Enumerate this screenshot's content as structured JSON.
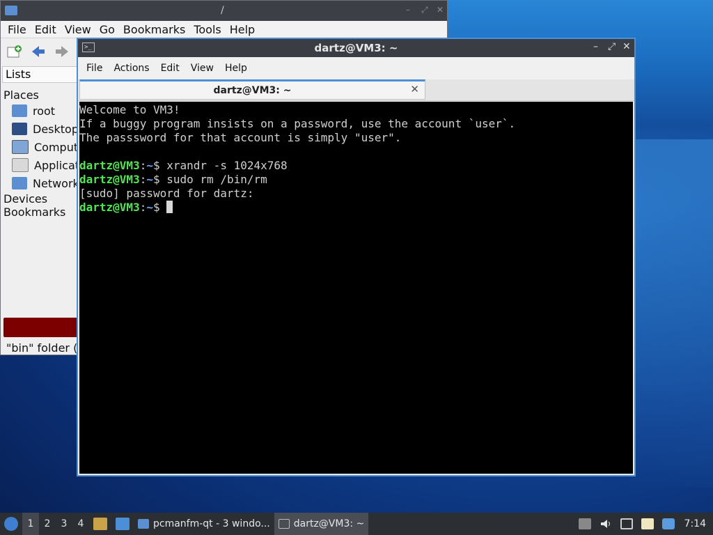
{
  "file_manager": {
    "title": "/",
    "menu": [
      "File",
      "Edit",
      "View",
      "Go",
      "Bookmarks",
      "Tools",
      "Help"
    ],
    "side_tab": "Lists",
    "places_header": "Places",
    "places": [
      "root",
      "Desktop",
      "Computer",
      "Applications",
      "Network"
    ],
    "devices_header": "Devices",
    "bookmarks_header": "Bookmarks",
    "status": "\"bin\" folder (",
    "accent_color": "#7d0000"
  },
  "terminal": {
    "title": "dartz@VM3: ~",
    "menu": [
      "File",
      "Actions",
      "Edit",
      "View",
      "Help"
    ],
    "tab_label": "dartz@VM3: ~",
    "lines": [
      {
        "text": "Welcome to VM3!"
      },
      {
        "text": "If a buggy program insists on a password, use the account `user`."
      },
      {
        "text": "The passsword for that account is simply \"user\"."
      },
      {
        "text": ""
      },
      {
        "user": "dartz@VM3",
        "path": "~",
        "cmd": "xrandr -s 1024x768"
      },
      {
        "user": "dartz@VM3",
        "path": "~",
        "cmd": "sudo rm /bin/rm"
      },
      {
        "text": "[sudo] password for dartz:"
      },
      {
        "user": "dartz@VM3",
        "path": "~",
        "cmd": "",
        "cursor": true
      }
    ]
  },
  "taskbar": {
    "workspaces": [
      "1",
      "2",
      "3",
      "4"
    ],
    "active_workspace": "1",
    "tasks": [
      {
        "label": "pcmanfm-qt - 3 windo...",
        "icon": "folder-icon"
      },
      {
        "label": "dartz@VM3: ~",
        "icon": "terminal-icon"
      }
    ],
    "clock": "7:14"
  }
}
